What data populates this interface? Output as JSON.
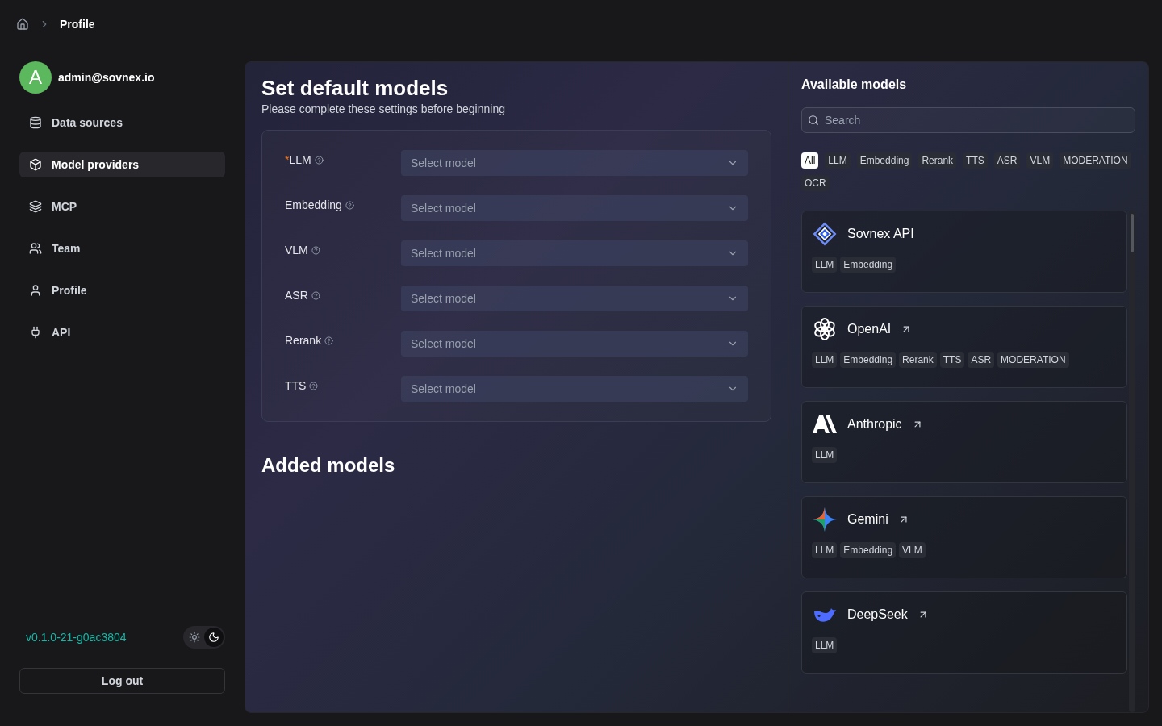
{
  "breadcrumb": {
    "current": "Profile"
  },
  "user": {
    "avatar_letter": "A",
    "email": "admin@sovnex.io"
  },
  "sidebar": {
    "items": [
      {
        "label": "Data sources",
        "kind": "database",
        "selected": false
      },
      {
        "label": "Model providers",
        "kind": "box",
        "selected": true
      },
      {
        "label": "MCP",
        "kind": "mcp",
        "selected": false
      },
      {
        "label": "Team",
        "kind": "team",
        "selected": false
      },
      {
        "label": "Profile",
        "kind": "user",
        "selected": false
      },
      {
        "label": "API",
        "kind": "plug",
        "selected": false
      }
    ]
  },
  "version": "v0.1.0-21-g0ac3804",
  "theme_toggle": [
    {
      "kind": "light",
      "selected": false
    },
    {
      "kind": "dark",
      "selected": true
    }
  ],
  "logout": "Log out",
  "defaults": {
    "title": "Set default models",
    "subtitle": "Please complete these settings before beginning",
    "fields": [
      {
        "required_mark": "*",
        "label": "LLM",
        "placeholder": "Select model"
      },
      {
        "label": "Embedding",
        "placeholder": "Select model"
      },
      {
        "label": "VLM",
        "placeholder": "Select model"
      },
      {
        "label": "ASR",
        "placeholder": "Select model"
      },
      {
        "label": "Rerank",
        "placeholder": "Select model"
      },
      {
        "label": "TTS",
        "placeholder": "Select model"
      }
    ]
  },
  "added": {
    "title": "Added models"
  },
  "available": {
    "title": "Available models",
    "search": {
      "placeholder": "Search"
    },
    "filters": [
      {
        "label": "All",
        "selected": true
      },
      {
        "label": "LLM",
        "selected": false
      },
      {
        "label": "Embedding",
        "selected": false
      },
      {
        "label": "Rerank",
        "selected": false
      },
      {
        "label": "TTS",
        "selected": false
      },
      {
        "label": "ASR",
        "selected": false
      },
      {
        "label": "VLM",
        "selected": false
      },
      {
        "label": "MODERATION",
        "selected": false
      },
      {
        "label": "OCR",
        "selected": false
      }
    ],
    "providers": [
      {
        "name": "Sovnex API",
        "kind": "diamond",
        "external_link": false,
        "tags": [
          "LLM",
          "Embedding"
        ]
      },
      {
        "name": "OpenAI",
        "kind": "knot",
        "external_link": true,
        "tags": [
          "LLM",
          "Embedding",
          "Rerank",
          "TTS",
          "ASR",
          "MODERATION"
        ]
      },
      {
        "name": "Anthropic",
        "kind": "slash",
        "external_link": true,
        "tags": [
          "LLM"
        ]
      },
      {
        "name": "Gemini",
        "kind": "star",
        "external_link": true,
        "tags": [
          "LLM",
          "Embedding",
          "VLM"
        ]
      },
      {
        "name": "DeepSeek",
        "kind": "whale",
        "external_link": true,
        "tags": [
          "LLM"
        ]
      }
    ]
  }
}
